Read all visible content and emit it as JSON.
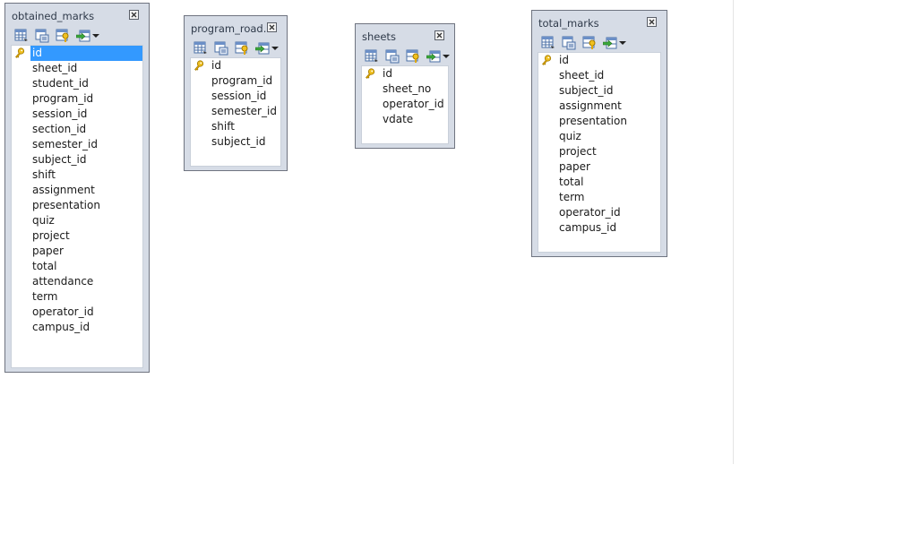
{
  "tables": [
    {
      "name": "obtained_marks",
      "selected_index": 0,
      "columns": [
        "id",
        "sheet_id",
        "student_id",
        "program_id",
        "session_id",
        "section_id",
        "semester_id",
        "subject_id",
        "shift",
        "assignment",
        "presentation",
        "quiz",
        "project",
        "paper",
        "total",
        "attendance",
        "term",
        "operator_id",
        "campus_id"
      ]
    },
    {
      "name": "program_road...",
      "selected_index": -1,
      "columns": [
        "id",
        "program_id",
        "session_id",
        "semester_id",
        "shift",
        "subject_id"
      ]
    },
    {
      "name": "sheets",
      "selected_index": -1,
      "columns": [
        "id",
        "sheet_no",
        "operator_id",
        "vdate"
      ]
    },
    {
      "name": "total_marks",
      "selected_index": -1,
      "columns": [
        "id",
        "sheet_id",
        "subject_id",
        "assignment",
        "presentation",
        "quiz",
        "project",
        "paper",
        "total",
        "term",
        "operator_id",
        "campus_id"
      ]
    }
  ],
  "toolbar_icons": [
    "table-grid-icon",
    "table-properties-icon",
    "table-key-icon",
    "import-icon",
    "dropdown-arrow-icon"
  ],
  "colors": {
    "window_bg": "#d6dce6",
    "window_border": "#6f7480",
    "selection": "#3399ff",
    "key_icon": "#e0a800"
  }
}
